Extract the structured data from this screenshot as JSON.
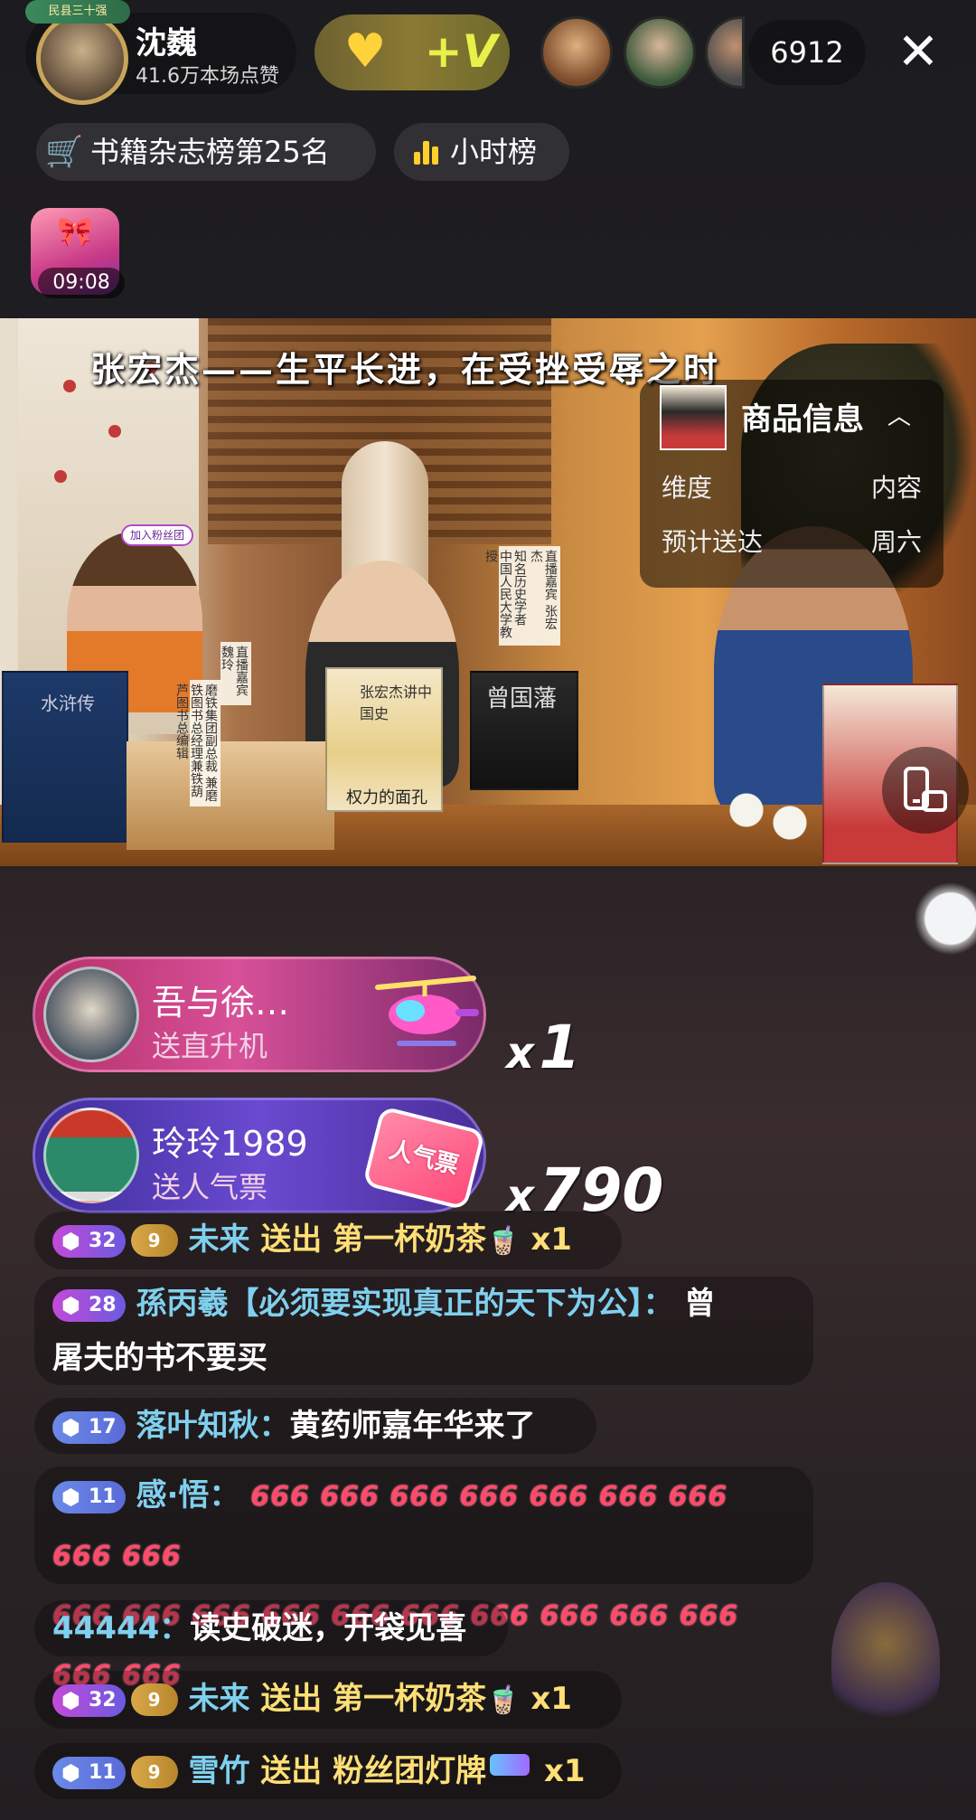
{
  "header": {
    "host_badge": "民县三十强",
    "host_name": "沈巍",
    "host_likes": "41.6万本场点赞",
    "viewer_count": "6912",
    "close_label": "✕",
    "heart_icon": "heart-plus-icon",
    "v_label": "+V"
  },
  "rank": {
    "book_rank": "书籍杂志榜第25名",
    "hourly": "小时榜"
  },
  "red_packet": {
    "timer": "09:08"
  },
  "video": {
    "subtitle": "张宏杰——生平长进，在受挫受辱之时",
    "nameplate_guest": "直播嘉宾 张宏杰",
    "nameplate_guest2": "知名历史学者 中国人民大学教授",
    "nameplate_host": "直播嘉宾 魏玲",
    "nameplate_host2": "磨铁集团副总裁 兼磨铁图书总经理兼铁葫芦图书总编辑",
    "join_badge": "加入粉丝团",
    "book1": "张宏杰讲中国史",
    "book2": "权力的面孔",
    "book3": "曾国藩",
    "book4": "水浒传"
  },
  "product": {
    "title": "商品信息",
    "row1_k": "维度",
    "row1_v": "内容",
    "row2_k": "预计送达",
    "row2_v": "周六"
  },
  "gifts": [
    {
      "name": "吾与徐…",
      "action": "送直升机",
      "x": "x",
      "count": "1",
      "icon": "helicopter-icon"
    },
    {
      "name": "玲玲1989",
      "action": "送人气票",
      "x": "x",
      "count": "790",
      "icon": "popularity-ticket-icon",
      "ticket_text": "人气票"
    }
  ],
  "chat": [
    {
      "level": "32",
      "fan": "9",
      "user": "未来",
      "verb": "送出",
      "gift": "第一杯奶茶",
      "count": "x1"
    },
    {
      "level": "28",
      "user": "孫丙羲【必须要实现真正的天下为公】：",
      "line1": "曾",
      "line2": "屠夫的书不要买"
    },
    {
      "level": "17",
      "user": "落叶知秋：",
      "text": "黄药师嘉年华来了"
    },
    {
      "level": "11",
      "user": "感·悟：",
      "line1": "666 666 666 666 666 666 666 666 666",
      "line2": "666 666 666 666 666 666 666 666 666 666 666 666"
    },
    {
      "user": "44444：",
      "text": "读史破迷，开袋见喜"
    },
    {
      "level": "32",
      "fan": "9",
      "user": "未来",
      "verb": "送出",
      "gift": "第一杯奶茶",
      "count": "x1"
    },
    {
      "level": "11",
      "fan": "9",
      "user": "雪竹",
      "verb": "送出",
      "gift": "粉丝团灯牌",
      "count": "x1"
    }
  ],
  "colors": {
    "username": "#7fd0ee",
    "gift_text": "#ffdf76",
    "level_purple": "#c44ad8",
    "level_blue": "#6a8ae8",
    "rank_accent": "#ffcf2a"
  }
}
